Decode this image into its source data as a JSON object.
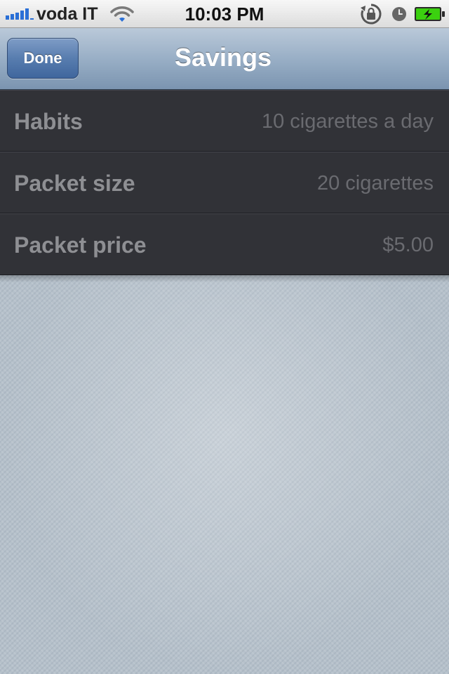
{
  "status_bar": {
    "carrier": "voda IT",
    "time": "10:03 PM",
    "signal_bars": 5,
    "battery_charging": true,
    "icons": [
      "signal-bars-icon",
      "wifi-icon",
      "rotation-lock-icon",
      "alarm-clock-icon",
      "battery-charging-icon"
    ]
  },
  "nav": {
    "done_label": "Done",
    "title": "Savings"
  },
  "settings": {
    "rows": [
      {
        "label": "Habits",
        "value": "10 cigarettes a day"
      },
      {
        "label": "Packet size",
        "value": "20 cigarettes"
      },
      {
        "label": "Packet price",
        "value": "$5.00"
      }
    ]
  },
  "colors": {
    "nav_bar": "#99afc6",
    "done_button": "#587daf",
    "row_background": "#313237",
    "row_label": "#8e8f93",
    "row_value": "#6a6b70",
    "content_background": "#b5c0ca",
    "signal_blue": "#2a6fd6",
    "battery_green": "#3bd10f"
  }
}
